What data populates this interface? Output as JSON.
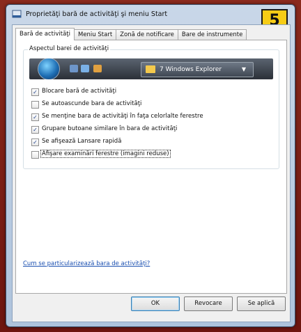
{
  "window": {
    "title": "Proprietăţi bară de activităţi şi meniu Start",
    "badge": "5"
  },
  "tabs": [
    {
      "label": "Bară de activităţi",
      "active": true
    },
    {
      "label": "Meniu Start",
      "active": false
    },
    {
      "label": "Zonă de notificare",
      "active": false
    },
    {
      "label": "Bare de instrumente",
      "active": false
    }
  ],
  "group": {
    "label": "Aspectul barei de activităţi",
    "preview": {
      "task_button": "7 Windows Explorer",
      "task_arrow": "▼"
    }
  },
  "checkboxes": [
    {
      "label": "Blocare bară de activităţi",
      "checked": true
    },
    {
      "label": "Se autoascunde bara de activităţi",
      "checked": false
    },
    {
      "label": "Se menţine bara de activităţi în faţa celorlalte ferestre",
      "checked": true
    },
    {
      "label": "Grupare butoane similare în bara de activităţi",
      "checked": true
    },
    {
      "label": "Se afişează Lansare rapidă",
      "checked": true
    },
    {
      "label": "Afişare examinări ferestre (imagini reduse)",
      "checked": false
    }
  ],
  "link": "Cum se particularizează bara de activităţi?",
  "buttons": {
    "ok": "OK",
    "cancel": "Revocare",
    "apply": "Se aplică"
  },
  "colors": {
    "accent_badge": "#f6cc16",
    "link": "#1a4fb0",
    "frame": "#7a1a12"
  }
}
